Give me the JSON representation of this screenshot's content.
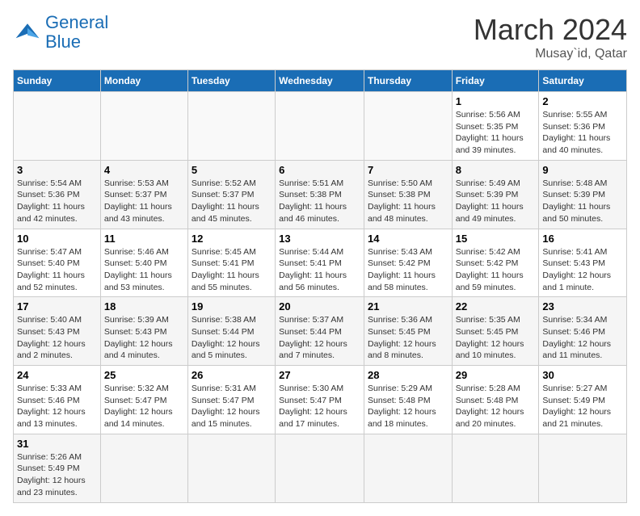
{
  "header": {
    "logo_general": "General",
    "logo_blue": "Blue",
    "title": "March 2024",
    "location": "Musay`id, Qatar"
  },
  "weekdays": [
    "Sunday",
    "Monday",
    "Tuesday",
    "Wednesday",
    "Thursday",
    "Friday",
    "Saturday"
  ],
  "weeks": [
    [
      {
        "day": "",
        "info": ""
      },
      {
        "day": "",
        "info": ""
      },
      {
        "day": "",
        "info": ""
      },
      {
        "day": "",
        "info": ""
      },
      {
        "day": "",
        "info": ""
      },
      {
        "day": "1",
        "info": "Sunrise: 5:56 AM\nSunset: 5:35 PM\nDaylight: 11 hours and 39 minutes."
      },
      {
        "day": "2",
        "info": "Sunrise: 5:55 AM\nSunset: 5:36 PM\nDaylight: 11 hours and 40 minutes."
      }
    ],
    [
      {
        "day": "3",
        "info": "Sunrise: 5:54 AM\nSunset: 5:36 PM\nDaylight: 11 hours and 42 minutes."
      },
      {
        "day": "4",
        "info": "Sunrise: 5:53 AM\nSunset: 5:37 PM\nDaylight: 11 hours and 43 minutes."
      },
      {
        "day": "5",
        "info": "Sunrise: 5:52 AM\nSunset: 5:37 PM\nDaylight: 11 hours and 45 minutes."
      },
      {
        "day": "6",
        "info": "Sunrise: 5:51 AM\nSunset: 5:38 PM\nDaylight: 11 hours and 46 minutes."
      },
      {
        "day": "7",
        "info": "Sunrise: 5:50 AM\nSunset: 5:38 PM\nDaylight: 11 hours and 48 minutes."
      },
      {
        "day": "8",
        "info": "Sunrise: 5:49 AM\nSunset: 5:39 PM\nDaylight: 11 hours and 49 minutes."
      },
      {
        "day": "9",
        "info": "Sunrise: 5:48 AM\nSunset: 5:39 PM\nDaylight: 11 hours and 50 minutes."
      }
    ],
    [
      {
        "day": "10",
        "info": "Sunrise: 5:47 AM\nSunset: 5:40 PM\nDaylight: 11 hours and 52 minutes."
      },
      {
        "day": "11",
        "info": "Sunrise: 5:46 AM\nSunset: 5:40 PM\nDaylight: 11 hours and 53 minutes."
      },
      {
        "day": "12",
        "info": "Sunrise: 5:45 AM\nSunset: 5:41 PM\nDaylight: 11 hours and 55 minutes."
      },
      {
        "day": "13",
        "info": "Sunrise: 5:44 AM\nSunset: 5:41 PM\nDaylight: 11 hours and 56 minutes."
      },
      {
        "day": "14",
        "info": "Sunrise: 5:43 AM\nSunset: 5:42 PM\nDaylight: 11 hours and 58 minutes."
      },
      {
        "day": "15",
        "info": "Sunrise: 5:42 AM\nSunset: 5:42 PM\nDaylight: 11 hours and 59 minutes."
      },
      {
        "day": "16",
        "info": "Sunrise: 5:41 AM\nSunset: 5:43 PM\nDaylight: 12 hours and 1 minute."
      }
    ],
    [
      {
        "day": "17",
        "info": "Sunrise: 5:40 AM\nSunset: 5:43 PM\nDaylight: 12 hours and 2 minutes."
      },
      {
        "day": "18",
        "info": "Sunrise: 5:39 AM\nSunset: 5:43 PM\nDaylight: 12 hours and 4 minutes."
      },
      {
        "day": "19",
        "info": "Sunrise: 5:38 AM\nSunset: 5:44 PM\nDaylight: 12 hours and 5 minutes."
      },
      {
        "day": "20",
        "info": "Sunrise: 5:37 AM\nSunset: 5:44 PM\nDaylight: 12 hours and 7 minutes."
      },
      {
        "day": "21",
        "info": "Sunrise: 5:36 AM\nSunset: 5:45 PM\nDaylight: 12 hours and 8 minutes."
      },
      {
        "day": "22",
        "info": "Sunrise: 5:35 AM\nSunset: 5:45 PM\nDaylight: 12 hours and 10 minutes."
      },
      {
        "day": "23",
        "info": "Sunrise: 5:34 AM\nSunset: 5:46 PM\nDaylight: 12 hours and 11 minutes."
      }
    ],
    [
      {
        "day": "24",
        "info": "Sunrise: 5:33 AM\nSunset: 5:46 PM\nDaylight: 12 hours and 13 minutes."
      },
      {
        "day": "25",
        "info": "Sunrise: 5:32 AM\nSunset: 5:47 PM\nDaylight: 12 hours and 14 minutes."
      },
      {
        "day": "26",
        "info": "Sunrise: 5:31 AM\nSunset: 5:47 PM\nDaylight: 12 hours and 15 minutes."
      },
      {
        "day": "27",
        "info": "Sunrise: 5:30 AM\nSunset: 5:47 PM\nDaylight: 12 hours and 17 minutes."
      },
      {
        "day": "28",
        "info": "Sunrise: 5:29 AM\nSunset: 5:48 PM\nDaylight: 12 hours and 18 minutes."
      },
      {
        "day": "29",
        "info": "Sunrise: 5:28 AM\nSunset: 5:48 PM\nDaylight: 12 hours and 20 minutes."
      },
      {
        "day": "30",
        "info": "Sunrise: 5:27 AM\nSunset: 5:49 PM\nDaylight: 12 hours and 21 minutes."
      }
    ],
    [
      {
        "day": "31",
        "info": "Sunrise: 5:26 AM\nSunset: 5:49 PM\nDaylight: 12 hours and 23 minutes."
      },
      {
        "day": "",
        "info": ""
      },
      {
        "day": "",
        "info": ""
      },
      {
        "day": "",
        "info": ""
      },
      {
        "day": "",
        "info": ""
      },
      {
        "day": "",
        "info": ""
      },
      {
        "day": "",
        "info": ""
      }
    ]
  ]
}
